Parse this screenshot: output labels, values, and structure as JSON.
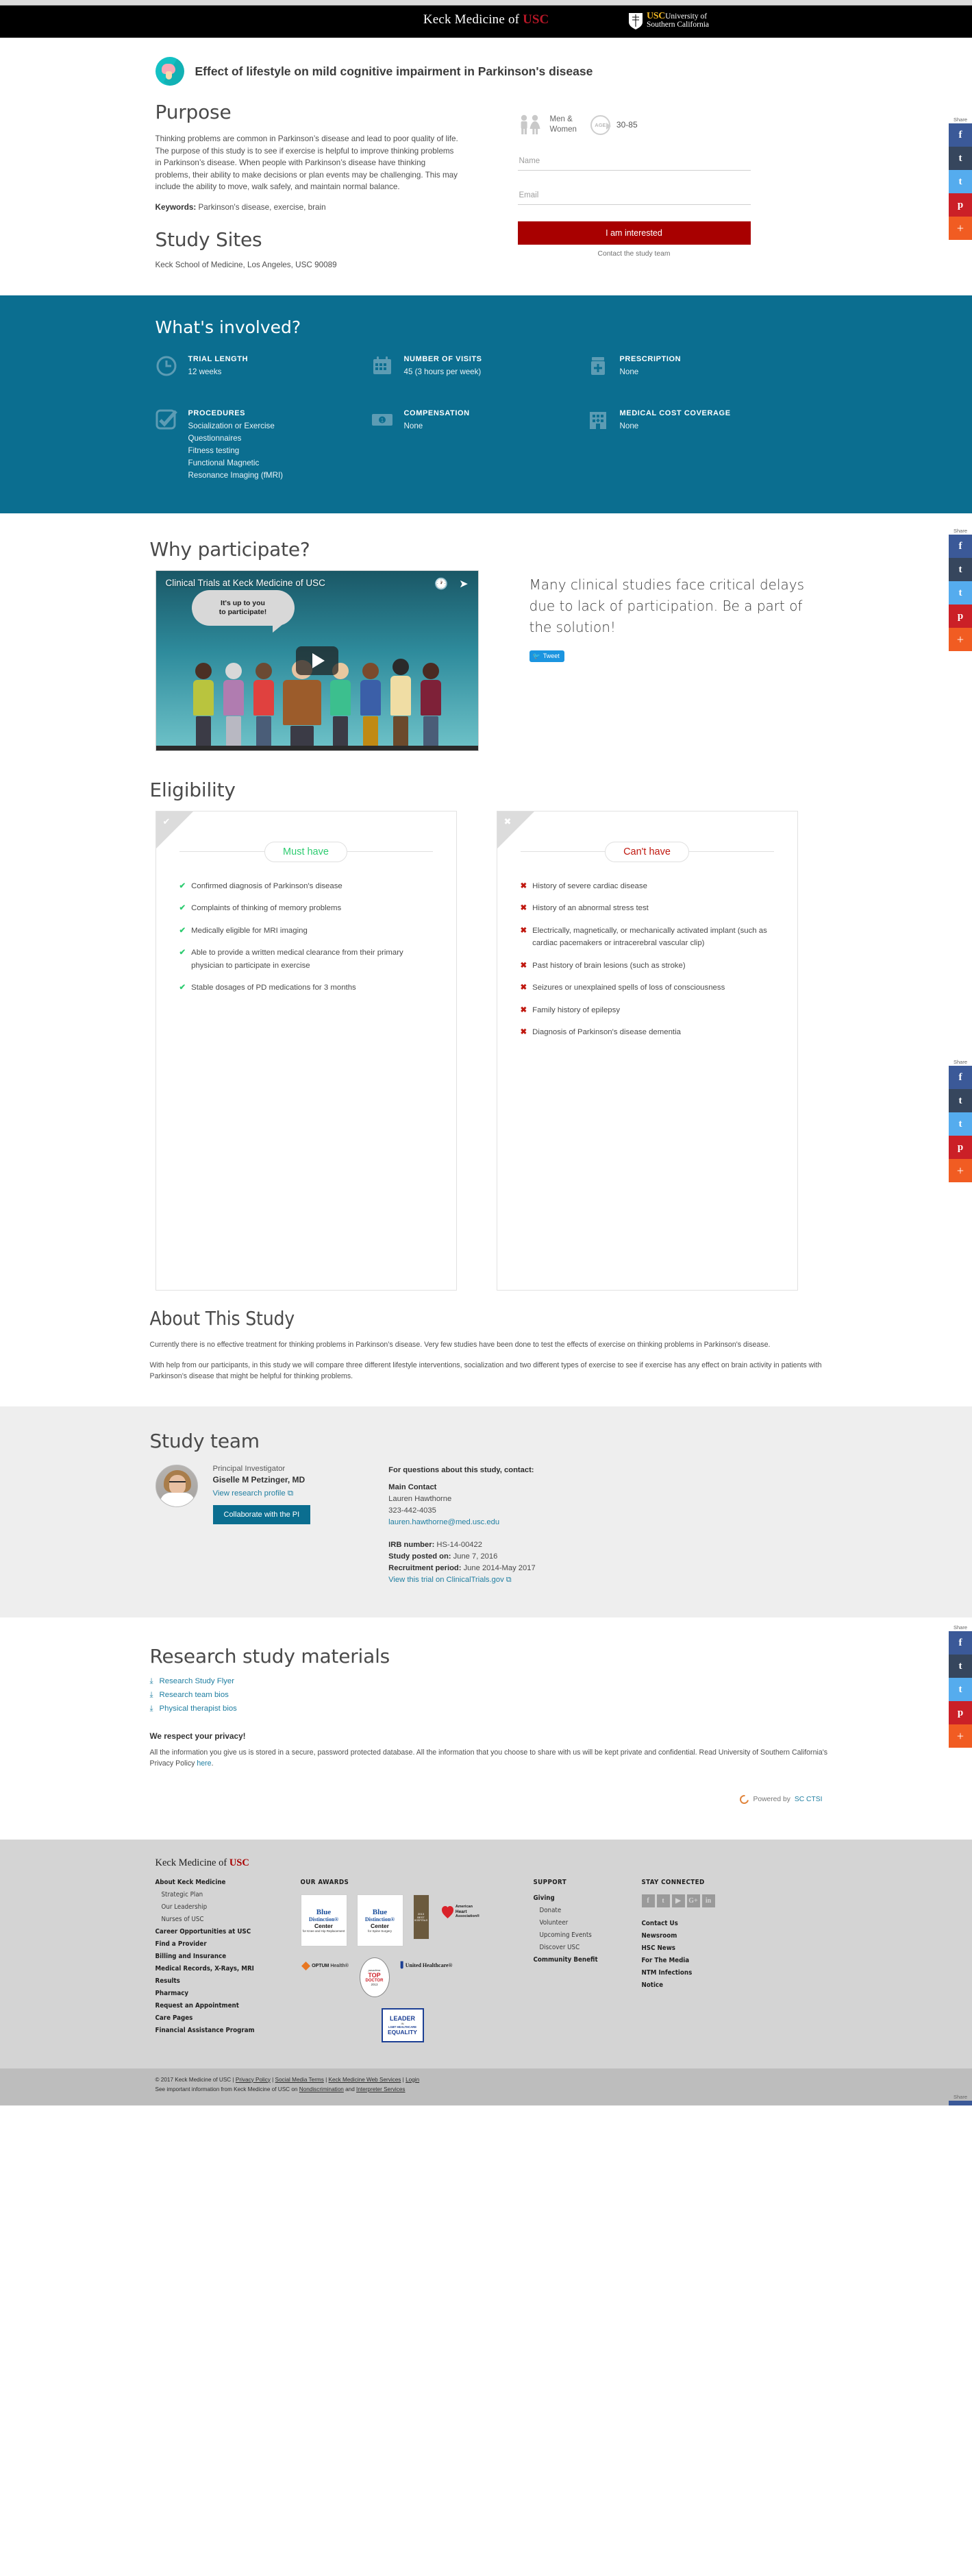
{
  "topbar": {
    "keck_logo_pre": "Keck Medicine of ",
    "keck_logo_usc": "USC",
    "usc_abbr": "USC",
    "usc_line1": "University of",
    "usc_line2": "Southern California"
  },
  "hero": {
    "icon_name": "brain-icon",
    "title": "Effect of lifestyle on mild cognitive impairment in Parkinson's disease",
    "purpose_heading": "Purpose",
    "purpose_text": "Thinking problems are common in Parkinson’s disease and lead to poor quality of life. The purpose of this study is to see if exercise is helpful to improve thinking problems in Parkinson’s disease. When people with Parkinson’s disease have thinking problems, their ability to make decisions or plan events may be challenging. This may include the ability to move, walk safely, and maintain normal balance.",
    "keywords_label": "Keywords:",
    "keywords_value": " Parkinson's disease, exercise, brain",
    "sites_heading": "Study Sites",
    "sites_value": "Keck School of Medicine, Los Angeles, USC 90089"
  },
  "signup": {
    "gender_label_line1": "Men &",
    "gender_label_line2": "Women",
    "age_badge": "AGE",
    "age_value": "30-85",
    "name_placeholder": "Name",
    "name_value": "",
    "email_placeholder": "Email",
    "email_value": "",
    "submit_label": "I am interested",
    "contact_link": "Contact the study team"
  },
  "involved": {
    "heading": "What's involved?",
    "items": [
      {
        "icon": "clock-icon",
        "label": "TRIAL LENGTH",
        "value": "12 weeks"
      },
      {
        "icon": "calendar-icon",
        "label": "NUMBER OF VISITS",
        "value": "45 (3 hours per week)"
      },
      {
        "icon": "pill-bottle-icon",
        "label": "PRESCRIPTION",
        "value": "None"
      },
      {
        "icon": "checkbox-icon",
        "label": "PROCEDURES",
        "value": "Socialization or Exercise\nQuestionnaires\nFitness testing\nFunctional Magnetic\nResonance Imaging (fMRI)"
      },
      {
        "icon": "money-icon",
        "label": "COMPENSATION",
        "value": "None"
      },
      {
        "icon": "hospital-icon",
        "label": "MEDICAL COST COVERAGE",
        "value": "None"
      }
    ]
  },
  "why": {
    "heading": "Why participate?",
    "video_title": "Clinical Trials at Keck Medicine of USC",
    "video_bubble_line1": "It's up to you",
    "video_bubble_line2": "to participate!",
    "statement": "Many clinical studies face critical delays due to lack of participation. Be a part of the solution!",
    "tweet_label": "Tweet"
  },
  "eligibility": {
    "heading": "Eligibility",
    "must_have": {
      "pill": "Must have",
      "items": [
        "Confirmed diagnosis of Parkinson's disease",
        "Complaints of thinking of memory problems",
        "Medically eligible for MRI imaging",
        "Able to provide a written medical clearance from their primary physician to participate in exercise",
        "Stable dosages of PD medications for 3 months"
      ]
    },
    "cant_have": {
      "pill": "Can't have",
      "items": [
        "History of severe cardiac disease",
        "History of an abnormal stress test",
        "Electrically, magnetically, or mechanically activated implant (such as cardiac pacemakers or intracerebral vascular clip)",
        "Past history of brain lesions (such as stroke)",
        "Seizures or unexplained spells of loss of consciousness",
        "Family history of epilepsy",
        "Diagnosis of Parkinson's disease dementia"
      ]
    }
  },
  "about": {
    "heading": "About This Study",
    "paragraph1": "Currently there is no effective treatment for thinking problems in Parkinson’s disease. Very few studies have been done to test the effects of exercise on thinking problems in Parkinson's disease.",
    "paragraph2": "With help from our participants, in this study we will compare three different lifestyle interventions, socialization and two different types of exercise to see if exercise has any effect on brain activity in patients with Parkinson’s disease that might be helpful for thinking problems."
  },
  "team": {
    "heading": "Study team",
    "role": "Principal Investigator",
    "name": "Giselle M Petzinger, MD",
    "profile_link": "View research profile",
    "collaborate_button": "Collaborate with the PI",
    "contact_heading": "For questions about this study, contact:",
    "contact_role": "Main Contact",
    "contact_name": "Lauren Hawthorne",
    "contact_phone": "323-442-4035",
    "contact_email": "lauren.hawthorne@med.usc.edu",
    "irb_label": "IRB number:",
    "irb_value": " HS-14-00422",
    "posted_label": "Study posted on:",
    "posted_value": " June 7, 2016",
    "recruit_label": "Recruitment period:",
    "recruit_value": " June 2014-May 2017",
    "ct_link": "View this trial on ClinicalTrials.gov"
  },
  "materials": {
    "heading": "Research study materials",
    "links": [
      "Research Study Flyer",
      "Research team bios",
      "Physical therapist bios"
    ],
    "privacy_heading": "We respect your privacy!",
    "privacy_text": "All the information you give us is stored in a secure, password protected database. All the information that you choose to share with us will be kept private and confidential. Read University of Southern California's Privacy Policy ",
    "privacy_link": "here",
    "privacy_text_end": ".",
    "powered_pre": "Powered by ",
    "powered_link": "SC CTSI"
  },
  "share_rail": {
    "label": "Share",
    "buttons": [
      {
        "name": "facebook-share-button",
        "glyph": "f"
      },
      {
        "name": "tumblr-share-button",
        "glyph": "t"
      },
      {
        "name": "twitter-share-button",
        "glyph": "t"
      },
      {
        "name": "pinterest-share-button",
        "glyph": "p"
      },
      {
        "name": "more-share-button",
        "glyph": "+"
      }
    ]
  },
  "footer": {
    "logo_pre": "Keck Medicine of ",
    "logo_usc": "USC",
    "col1": [
      {
        "label": "About Keck Medicine",
        "sub": false
      },
      {
        "label": "Strategic Plan",
        "sub": true
      },
      {
        "label": "Our Leadership",
        "sub": true
      },
      {
        "label": "Nurses of USC",
        "sub": true
      },
      {
        "label": "Career Opportunities at USC",
        "sub": false
      },
      {
        "label": "Find a Provider",
        "sub": false
      },
      {
        "label": "Billing and Insurance",
        "sub": false
      },
      {
        "label": "Medical Records, X-Rays, MRI",
        "sub": false
      },
      {
        "label": "Results",
        "sub": false
      },
      {
        "label": "Pharmacy",
        "sub": false
      },
      {
        "label": "Request an Appointment",
        "sub": false
      },
      {
        "label": "Care Pages",
        "sub": false
      },
      {
        "label": "Financial Assistance Program",
        "sub": false
      }
    ],
    "awards_heading": "OUR AWARDS",
    "awards": [
      {
        "name": "blue-distinction-knee-hip-award",
        "l1": "Blue",
        "l2": "Distinction®",
        "l3": "Center",
        "l4": "for Knee and Hip Replacement"
      },
      {
        "name": "blue-distinction-spine-award",
        "l1": "Blue",
        "l2": "Distinction®",
        "l3": "Center",
        "l4": "for Spine Surgery"
      },
      {
        "name": "us-news-best-hospitals-award",
        "l1": "2013",
        "l2": "BEST",
        "l3": "HOSPITALS",
        "l4": "USNWR"
      },
      {
        "name": "american-heart-association-award",
        "l1": "American",
        "l2": "Heart",
        "l3": "Association®",
        "l4": ""
      },
      {
        "name": "optum-health-award",
        "l1": "OPTUM",
        "l2": "Health®",
        "l3": "",
        "l4": ""
      },
      {
        "name": "pasadena-top-doctor-award",
        "l1": "pasadena",
        "l2": "TOP",
        "l3": "DOCTOR",
        "l4": "2013"
      },
      {
        "name": "united-healthcare-award",
        "l1": "United",
        "l2": "Healthcare®",
        "l3": "",
        "l4": ""
      },
      {
        "name": "lgbt-healthcare-equality-award",
        "l1": "LEADER",
        "l2": "IN",
        "l3": "LGBT HEALTHCARE",
        "l4": "EQUALITY"
      }
    ],
    "support_heading": "SUPPORT",
    "support": [
      {
        "label": "Giving",
        "sub": false
      },
      {
        "label": "Donate",
        "sub": true
      },
      {
        "label": "Volunteer",
        "sub": true
      },
      {
        "label": "Upcoming Events",
        "sub": true
      },
      {
        "label": "Discover USC",
        "sub": true
      },
      {
        "label": "Community Benefit",
        "sub": false
      }
    ],
    "connected_heading": "STAY CONNECTED",
    "social": [
      {
        "name": "facebook-icon",
        "glyph": "f"
      },
      {
        "name": "twitter-icon",
        "glyph": "t"
      },
      {
        "name": "youtube-icon",
        "glyph": "▶"
      },
      {
        "name": "google-plus-icon",
        "glyph": "G+"
      },
      {
        "name": "linkedin-icon",
        "glyph": "in"
      }
    ],
    "connected": [
      "Contact Us",
      "Newsroom",
      "HSC News",
      "For The Media",
      "NTM Infections",
      "Notice"
    ],
    "copyright": "© 2017 Keck Medicine of USC | ",
    "copy_links": [
      "Privacy Policy",
      "Social Media Terms",
      "Keck Medicine Web Services",
      "Login"
    ],
    "copy_note": "See important information from Keck Medicine of USC on ",
    "copy_note_link1": "Nondiscrimination",
    "copy_note_mid": " and ",
    "copy_note_link2": "Interpreter Services"
  }
}
